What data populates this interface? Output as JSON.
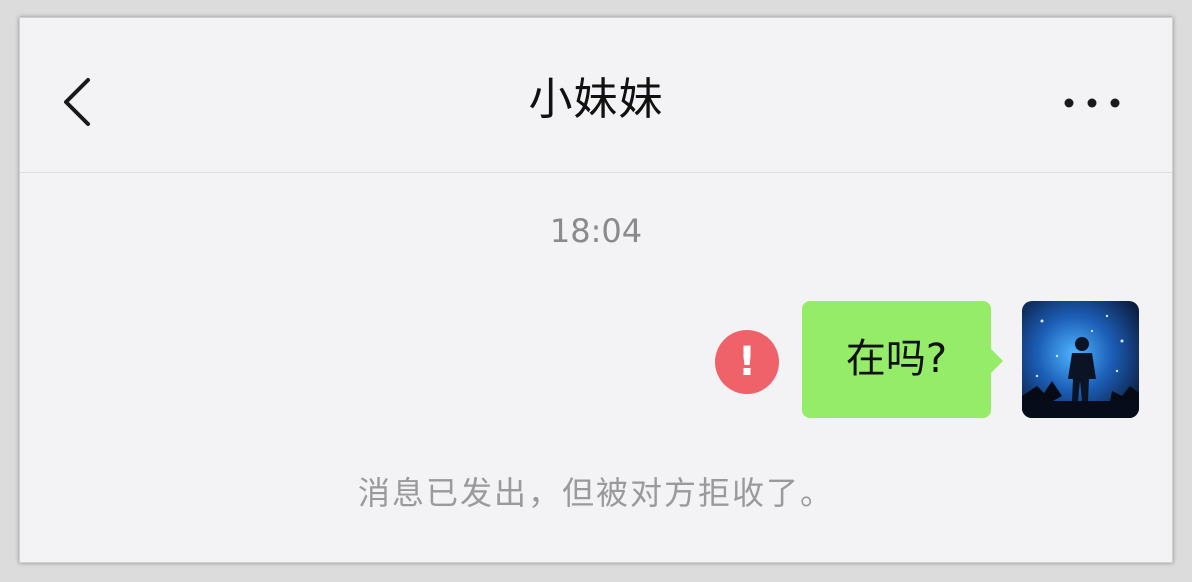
{
  "header": {
    "title": "小妹妹",
    "back_icon": "chevron-left-icon",
    "more_icon": "more-dots-icon"
  },
  "chat": {
    "timestamp": "18:04",
    "messages": [
      {
        "text": "在吗?",
        "sender": "self",
        "status_icon": "send-failed-icon",
        "status_symbol": "!"
      }
    ],
    "system_notice": "消息已发出，但被对方拒收了。"
  },
  "colors": {
    "bubble_self": "#95ec69",
    "fail_badge": "#f0626a",
    "background": "#f3f3f5",
    "secondary_text": "#8a8a8c"
  }
}
